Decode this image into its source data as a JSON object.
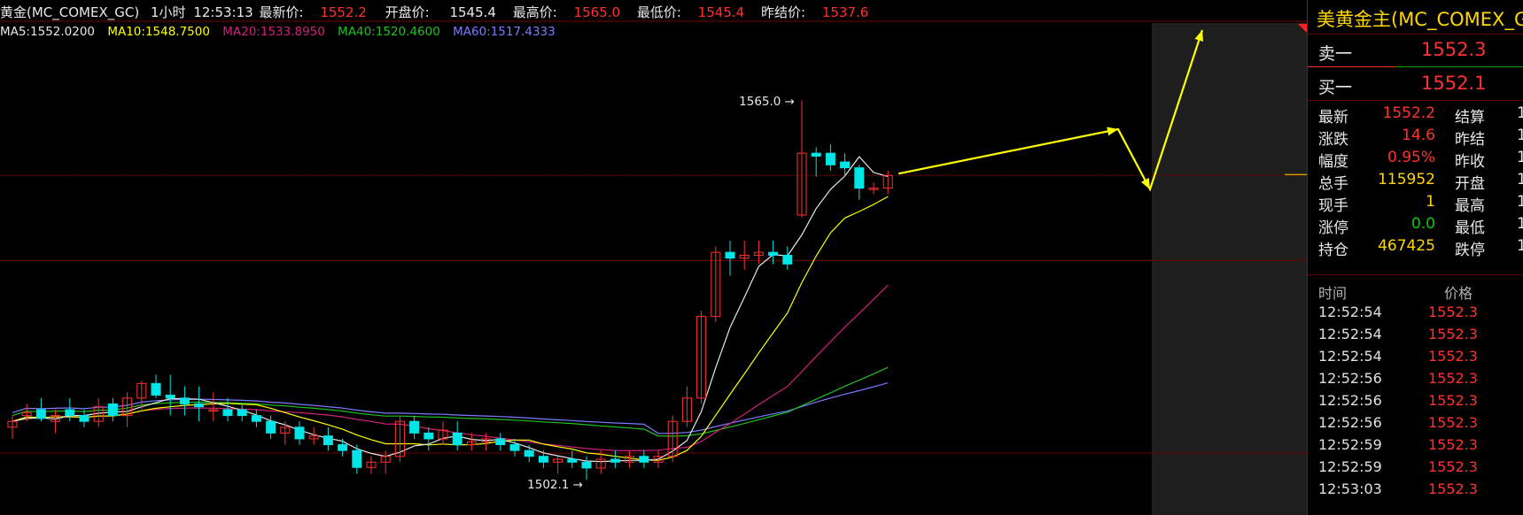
{
  "header": {
    "symbol_label": "黄金(MC_COMEX_GC)",
    "period": "1小时",
    "time": "12:53:13",
    "latest_label": "最新价:",
    "latest_value": "1552.2",
    "open_label": "开盘价:",
    "open_value": "1545.4",
    "high_label": "最高价:",
    "high_value": "1565.0",
    "low_label": "最低价:",
    "low_value": "1545.4",
    "prev_settle_label": "昨结价:",
    "prev_settle_value": "1537.6"
  },
  "ma_labels": [
    {
      "text": "MA5:1552.0200",
      "color": "#e8e8e8"
    },
    {
      "text": "MA10:1548.7500",
      "color": "#ffff00"
    },
    {
      "text": "MA20:1533.8950",
      "color": "#d0207a"
    },
    {
      "text": "MA40:1520.4600",
      "color": "#20c020"
    },
    {
      "text": "MA60:1517.4333",
      "color": "#7b7bff"
    }
  ],
  "annotations": {
    "high_marker": "1565.0",
    "low_marker": "1502.1"
  },
  "chart_data": {
    "type": "candlestick",
    "series_colors": {
      "up": "#ff3030",
      "down": "#00e5e5",
      "MA5": "#e8e8e8",
      "MA10": "#ffff00",
      "MA20": "#d0207a",
      "MA40": "#20c020",
      "MA60": "#7b7bff"
    },
    "y_range": [
      1495,
      1575
    ],
    "reference_lines": [
      1552.2,
      1537.6
    ],
    "forecast_arrow_color": "#ffff00",
    "candles": [
      {
        "o": 1509,
        "h": 1511,
        "l": 1507,
        "c": 1510
      },
      {
        "o": 1511,
        "h": 1513,
        "l": 1510,
        "c": 1511.5
      },
      {
        "o": 1512,
        "h": 1514,
        "l": 1510,
        "c": 1510.5
      },
      {
        "o": 1510,
        "h": 1512,
        "l": 1508,
        "c": 1511
      },
      {
        "o": 1512,
        "h": 1514,
        "l": 1510,
        "c": 1511
      },
      {
        "o": 1511,
        "h": 1512,
        "l": 1509,
        "c": 1510
      },
      {
        "o": 1510,
        "h": 1514,
        "l": 1509,
        "c": 1512.5
      },
      {
        "o": 1513,
        "h": 1514,
        "l": 1510,
        "c": 1511
      },
      {
        "o": 1511,
        "h": 1515,
        "l": 1509,
        "c": 1514
      },
      {
        "o": 1514,
        "h": 1517,
        "l": 1512,
        "c": 1516.5
      },
      {
        "o": 1516.5,
        "h": 1518,
        "l": 1514,
        "c": 1514.5
      },
      {
        "o": 1514.5,
        "h": 1518,
        "l": 1511,
        "c": 1514
      },
      {
        "o": 1514,
        "h": 1516,
        "l": 1511,
        "c": 1513
      },
      {
        "o": 1513,
        "h": 1516,
        "l": 1510,
        "c": 1512.5
      },
      {
        "o": 1512,
        "h": 1515,
        "l": 1510,
        "c": 1512
      },
      {
        "o": 1512,
        "h": 1514,
        "l": 1510,
        "c": 1511
      },
      {
        "o": 1512,
        "h": 1513,
        "l": 1510,
        "c": 1511
      },
      {
        "o": 1511,
        "h": 1512,
        "l": 1509,
        "c": 1510
      },
      {
        "o": 1510,
        "h": 1511,
        "l": 1507,
        "c": 1508
      },
      {
        "o": 1508,
        "h": 1510,
        "l": 1506,
        "c": 1509
      },
      {
        "o": 1509,
        "h": 1510,
        "l": 1506,
        "c": 1507
      },
      {
        "o": 1507,
        "h": 1509,
        "l": 1506,
        "c": 1507.5
      },
      {
        "o": 1507.5,
        "h": 1509,
        "l": 1505,
        "c": 1506
      },
      {
        "o": 1506,
        "h": 1507,
        "l": 1504,
        "c": 1505
      },
      {
        "o": 1505,
        "h": 1506,
        "l": 1501,
        "c": 1502.1
      },
      {
        "o": 1502.1,
        "h": 1504,
        "l": 1501,
        "c": 1503
      },
      {
        "o": 1503,
        "h": 1505,
        "l": 1501,
        "c": 1504
      },
      {
        "o": 1504,
        "h": 1511,
        "l": 1503,
        "c": 1510
      },
      {
        "o": 1510,
        "h": 1511,
        "l": 1507,
        "c": 1508
      },
      {
        "o": 1508,
        "h": 1509,
        "l": 1505,
        "c": 1507
      },
      {
        "o": 1507,
        "h": 1510,
        "l": 1506,
        "c": 1508.5
      },
      {
        "o": 1508,
        "h": 1510,
        "l": 1505,
        "c": 1506
      },
      {
        "o": 1506,
        "h": 1508,
        "l": 1505,
        "c": 1506.5
      },
      {
        "o": 1506.5,
        "h": 1508,
        "l": 1505,
        "c": 1507
      },
      {
        "o": 1507,
        "h": 1508,
        "l": 1505,
        "c": 1506
      },
      {
        "o": 1506,
        "h": 1507,
        "l": 1504,
        "c": 1505
      },
      {
        "o": 1505,
        "h": 1506,
        "l": 1503,
        "c": 1504
      },
      {
        "o": 1504,
        "h": 1505,
        "l": 1502,
        "c": 1503
      },
      {
        "o": 1503,
        "h": 1504,
        "l": 1501,
        "c": 1503.5
      },
      {
        "o": 1503.5,
        "h": 1505,
        "l": 1502,
        "c": 1503
      },
      {
        "o": 1503,
        "h": 1504,
        "l": 1500,
        "c": 1502
      },
      {
        "o": 1502,
        "h": 1505,
        "l": 1501,
        "c": 1503.5
      },
      {
        "o": 1503.5,
        "h": 1505,
        "l": 1502,
        "c": 1503
      },
      {
        "o": 1503,
        "h": 1505,
        "l": 1502,
        "c": 1504
      },
      {
        "o": 1504,
        "h": 1505,
        "l": 1502,
        "c": 1503
      },
      {
        "o": 1503,
        "h": 1505,
        "l": 1502,
        "c": 1504
      },
      {
        "o": 1504,
        "h": 1511,
        "l": 1503,
        "c": 1510
      },
      {
        "o": 1510,
        "h": 1516,
        "l": 1509,
        "c": 1514
      },
      {
        "o": 1514,
        "h": 1529,
        "l": 1513,
        "c": 1528
      },
      {
        "o": 1528,
        "h": 1540,
        "l": 1527,
        "c": 1539
      },
      {
        "o": 1539,
        "h": 1541,
        "l": 1535,
        "c": 1538
      },
      {
        "o": 1538,
        "h": 1541,
        "l": 1536,
        "c": 1538.5
      },
      {
        "o": 1538.5,
        "h": 1541,
        "l": 1537,
        "c": 1539
      },
      {
        "o": 1539,
        "h": 1541,
        "l": 1537,
        "c": 1538.5
      },
      {
        "o": 1538.5,
        "h": 1540,
        "l": 1536,
        "c": 1537
      },
      {
        "o": 1545.4,
        "h": 1565.0,
        "l": 1545,
        "c": 1556
      },
      {
        "o": 1556,
        "h": 1557,
        "l": 1552,
        "c": 1555.5
      },
      {
        "o": 1556,
        "h": 1557.5,
        "l": 1553,
        "c": 1554
      },
      {
        "o": 1554.5,
        "h": 1556,
        "l": 1552,
        "c": 1553.5
      },
      {
        "o": 1553.5,
        "h": 1554,
        "l": 1548,
        "c": 1550
      },
      {
        "o": 1550,
        "h": 1551,
        "l": 1549,
        "c": 1550
      },
      {
        "o": 1550,
        "h": 1553,
        "l": 1549,
        "c": 1552.2
      }
    ],
    "ma5": [
      1510,
      1510.5,
      1510.6,
      1510.4,
      1511,
      1511,
      1511.4,
      1511.6,
      1511.7,
      1512.5,
      1513.2,
      1513.9,
      1513.9,
      1513.8,
      1513.2,
      1512.6,
      1511.9,
      1511.1,
      1510.1,
      1509.4,
      1508.5,
      1507.7,
      1507.1,
      1506.6,
      1505.3,
      1504.5,
      1504,
      1504.7,
      1505.8,
      1506.1,
      1507.1,
      1507.5,
      1506.9,
      1506.7,
      1506.9,
      1506.3,
      1505.5,
      1504.6,
      1504.1,
      1503.6,
      1503.2,
      1503.1,
      1503.2,
      1503.3,
      1503.3,
      1503.5,
      1504.9,
      1506.7,
      1511.7,
      1519.2,
      1526.1,
      1531.3,
      1536.6,
      1538.6,
      1538.4,
      1542,
      1546.5,
      1549.8,
      1552.1,
      1555.4,
      1552.7,
      1552.0
    ]
  },
  "quote": {
    "title": "美黄金主(MC_COMEX_GC)",
    "ask_label": "卖一",
    "ask_price": "1552.3",
    "bid_label": "买一",
    "bid_price": "1552.1",
    "stats": [
      {
        "k1": "最新",
        "v1": "1552.2",
        "c1": "red",
        "k2": "结算",
        "v2": "1"
      },
      {
        "k1": "涨跌",
        "v1": "14.6",
        "c1": "red",
        "k2": "昨结",
        "v2": "1"
      },
      {
        "k1": "幅度",
        "v1": "0.95%",
        "c1": "red",
        "k2": "昨收",
        "v2": "1"
      },
      {
        "k1": "总手",
        "v1": "115952",
        "c1": "yellow",
        "k2": "开盘",
        "v2": "1"
      },
      {
        "k1": "现手",
        "v1": "1",
        "c1": "yellow",
        "k2": "最高",
        "v2": "1"
      },
      {
        "k1": "涨停",
        "v1": "0.0",
        "c1": "green",
        "k2": "最低",
        "v2": "1"
      },
      {
        "k1": "持仓",
        "v1": "467425",
        "c1": "yellow",
        "k2": "跌停",
        "v2": "1"
      }
    ],
    "ticks_header": {
      "time": "时间",
      "price": "价格"
    },
    "ticks": [
      {
        "time": "12:52:54",
        "price": "1552.3"
      },
      {
        "time": "12:52:54",
        "price": "1552.3"
      },
      {
        "time": "12:52:54",
        "price": "1552.3"
      },
      {
        "time": "12:52:56",
        "price": "1552.3"
      },
      {
        "time": "12:52:56",
        "price": "1552.3"
      },
      {
        "time": "12:52:56",
        "price": "1552.3"
      },
      {
        "time": "12:52:59",
        "price": "1552.3"
      },
      {
        "time": "12:52:59",
        "price": "1552.3"
      },
      {
        "time": "12:53:03",
        "price": "1552.3"
      }
    ]
  }
}
